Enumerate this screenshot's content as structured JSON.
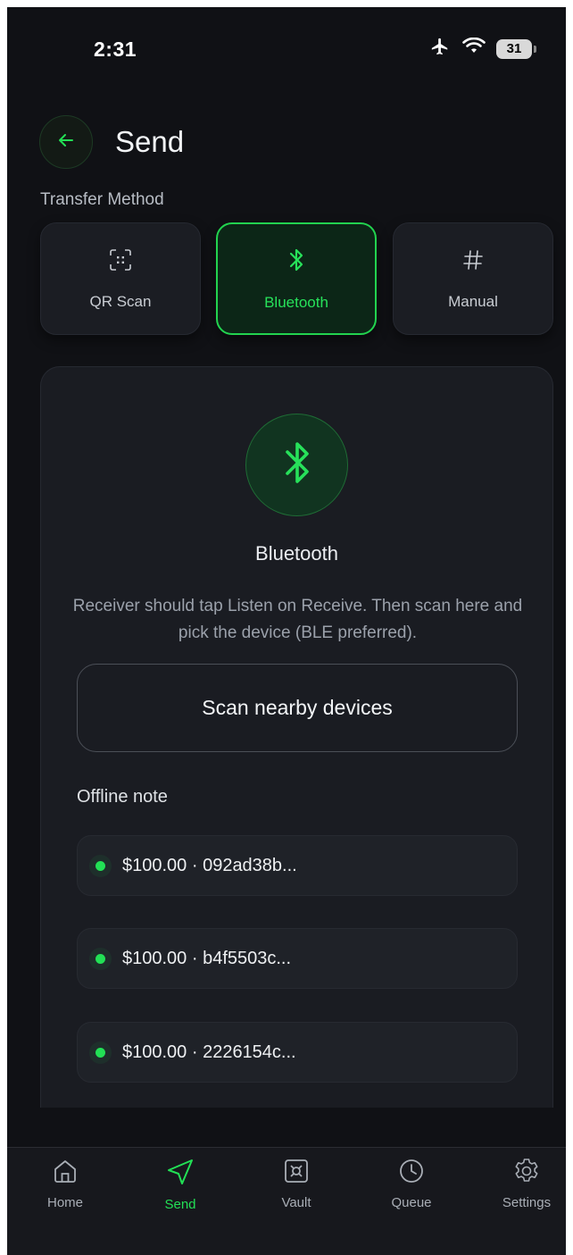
{
  "status_bar": {
    "time": "2:31",
    "battery": "31"
  },
  "header": {
    "title": "Send"
  },
  "transfer": {
    "label": "Transfer Method",
    "methods": [
      {
        "label": "QR Scan",
        "icon": "qr-scan-icon",
        "active": false
      },
      {
        "label": "Bluetooth",
        "icon": "bluetooth-icon",
        "active": true
      },
      {
        "label": "Manual",
        "icon": "hash-icon",
        "active": false
      }
    ]
  },
  "panel": {
    "title": "Bluetooth",
    "description": "Receiver should tap Listen on Receive. Then scan here and pick the device (BLE preferred).",
    "scan_button": "Scan nearby devices",
    "offline_label": "Offline note",
    "notes": [
      {
        "text": "$100.00 · 092ad38b..."
      },
      {
        "text": "$100.00 · b4f5503c..."
      },
      {
        "text": "$100.00 · 2226154c..."
      }
    ]
  },
  "nav": {
    "items": [
      {
        "label": "Home",
        "icon": "home-icon"
      },
      {
        "label": "Send",
        "icon": "send-icon",
        "active": true
      },
      {
        "label": "Vault",
        "icon": "vault-icon"
      },
      {
        "label": "Queue",
        "icon": "clock-icon"
      },
      {
        "label": "Settings",
        "icon": "gear-icon"
      }
    ]
  },
  "colors": {
    "accent": "#22e055",
    "background": "#101115",
    "card": "#1a1c22"
  }
}
